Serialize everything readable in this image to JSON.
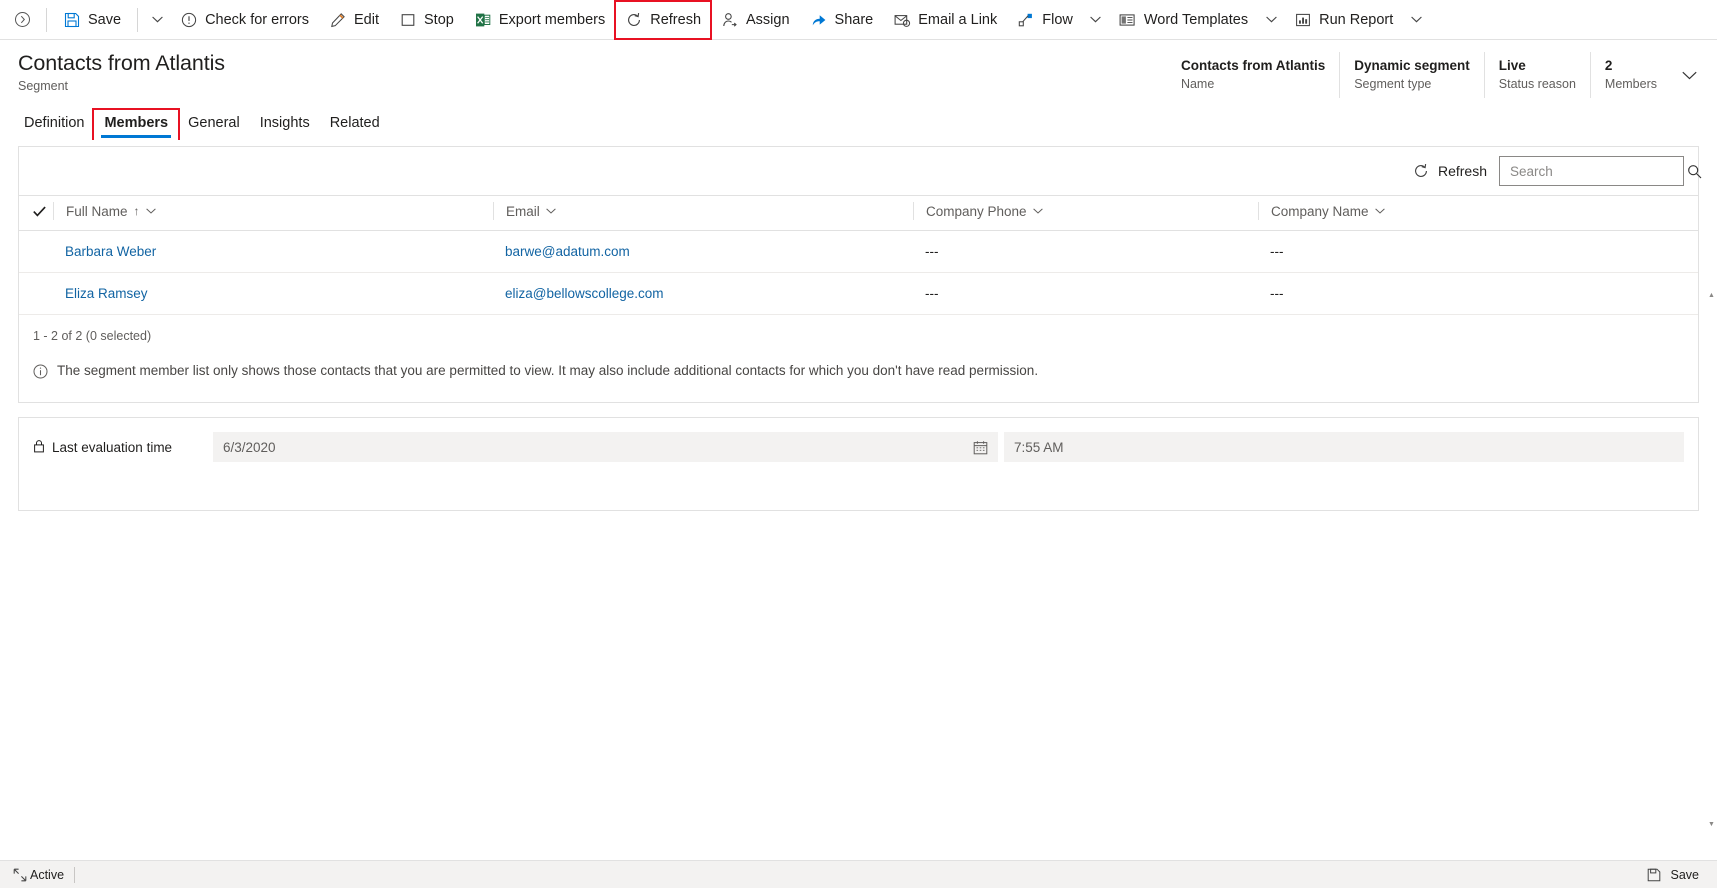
{
  "commandbar": {
    "back_icon": "back-circle-icon",
    "items": [
      {
        "label": "Save",
        "icon": "save-icon",
        "caret": true
      },
      {
        "label": "Check for errors",
        "icon": "error-circle-icon",
        "caret": false
      },
      {
        "label": "Edit",
        "icon": "pencil-icon",
        "caret": false
      },
      {
        "label": "Stop",
        "icon": "stop-square-icon",
        "caret": false
      },
      {
        "label": "Export members",
        "icon": "excel-icon",
        "caret": false
      },
      {
        "label": "Refresh",
        "icon": "refresh-icon",
        "caret": false,
        "highlighted": true
      },
      {
        "label": "Assign",
        "icon": "assign-person-icon",
        "caret": false
      },
      {
        "label": "Share",
        "icon": "share-icon",
        "caret": false
      },
      {
        "label": "Email a Link",
        "icon": "email-link-icon",
        "caret": false
      },
      {
        "label": "Flow",
        "icon": "flow-icon",
        "caret": true
      },
      {
        "label": "Word Templates",
        "icon": "word-template-icon",
        "caret": true
      },
      {
        "label": "Run Report",
        "icon": "run-report-icon",
        "caret": true
      }
    ]
  },
  "header": {
    "title": "Contacts from Atlantis",
    "subtitle": "Segment",
    "summary": [
      {
        "value": "Contacts from Atlantis",
        "label": "Name"
      },
      {
        "value": "Dynamic segment",
        "label": "Segment type"
      },
      {
        "value": "Live",
        "label": "Status reason"
      },
      {
        "value": "2",
        "label": "Members"
      }
    ],
    "expand_icon": "chevron-down-icon"
  },
  "tabs": [
    {
      "label": "Definition",
      "active": false
    },
    {
      "label": "Members",
      "active": true,
      "highlighted": true
    },
    {
      "label": "General",
      "active": false
    },
    {
      "label": "Insights",
      "active": false
    },
    {
      "label": "Related",
      "active": false
    }
  ],
  "grid": {
    "refresh_label": "Refresh",
    "refresh_icon": "refresh-icon",
    "search": {
      "value": "",
      "placeholder": "Search",
      "icon": "search-icon"
    },
    "select_all_icon": "checkmark-icon",
    "columns": [
      {
        "label": "Full Name",
        "sorted": true,
        "sort_icon": "sort-ascending-arrow"
      },
      {
        "label": "Email",
        "sorted": false
      },
      {
        "label": "Company Phone",
        "sorted": false
      },
      {
        "label": "Company Name",
        "sorted": false
      }
    ],
    "rows": [
      {
        "full_name": "Barbara Weber",
        "email": "barwe@adatum.com",
        "company_phone": "---",
        "company_name": "---"
      },
      {
        "full_name": "Eliza Ramsey",
        "email": "eliza@bellowscollege.com",
        "company_phone": "---",
        "company_name": "---"
      }
    ],
    "count_text": "1 - 2 of 2 (0 selected)",
    "notice_icon": "info-circle-icon",
    "notice_text": "The segment member list only shows those contacts that you are permitted to view. It may also include additional contacts for which you don't have read permission."
  },
  "evaluation": {
    "lock_icon": "lock-icon",
    "label": "Last evaluation time",
    "date_value": "6/3/2020",
    "calendar_icon": "calendar-icon",
    "time_value": "7:55 AM"
  },
  "statusbar": {
    "expand_icon": "expand-icon",
    "status_text": "Active",
    "save_label": "Save",
    "save_icon": "save-icon"
  },
  "colors": {
    "accent": "#0078d4",
    "link": "#1264a3",
    "highlight": "#e81123",
    "excel_green": "#217346"
  }
}
